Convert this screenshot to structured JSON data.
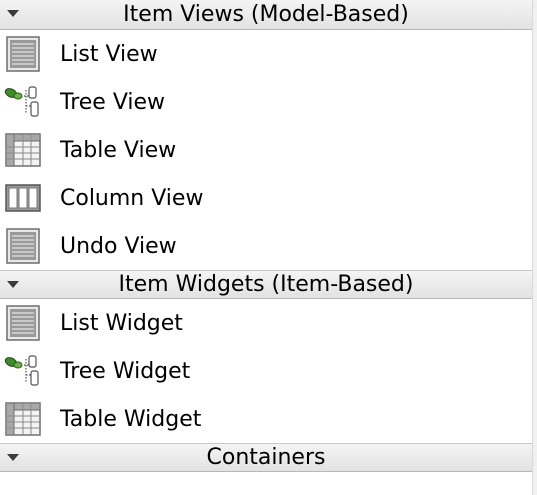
{
  "sections": [
    {
      "title": "Item Views (Model-Based)",
      "items": [
        {
          "label": "List View",
          "icon": "list-icon"
        },
        {
          "label": "Tree View",
          "icon": "tree-icon"
        },
        {
          "label": "Table View",
          "icon": "table-icon"
        },
        {
          "label": "Column View",
          "icon": "column-icon"
        },
        {
          "label": "Undo View",
          "icon": "list-icon"
        }
      ]
    },
    {
      "title": "Item Widgets (Item-Based)",
      "items": [
        {
          "label": "List Widget",
          "icon": "list-icon"
        },
        {
          "label": "Tree Widget",
          "icon": "tree-icon"
        },
        {
          "label": "Table Widget",
          "icon": "table-icon"
        }
      ]
    },
    {
      "title": "Containers",
      "items": []
    }
  ]
}
